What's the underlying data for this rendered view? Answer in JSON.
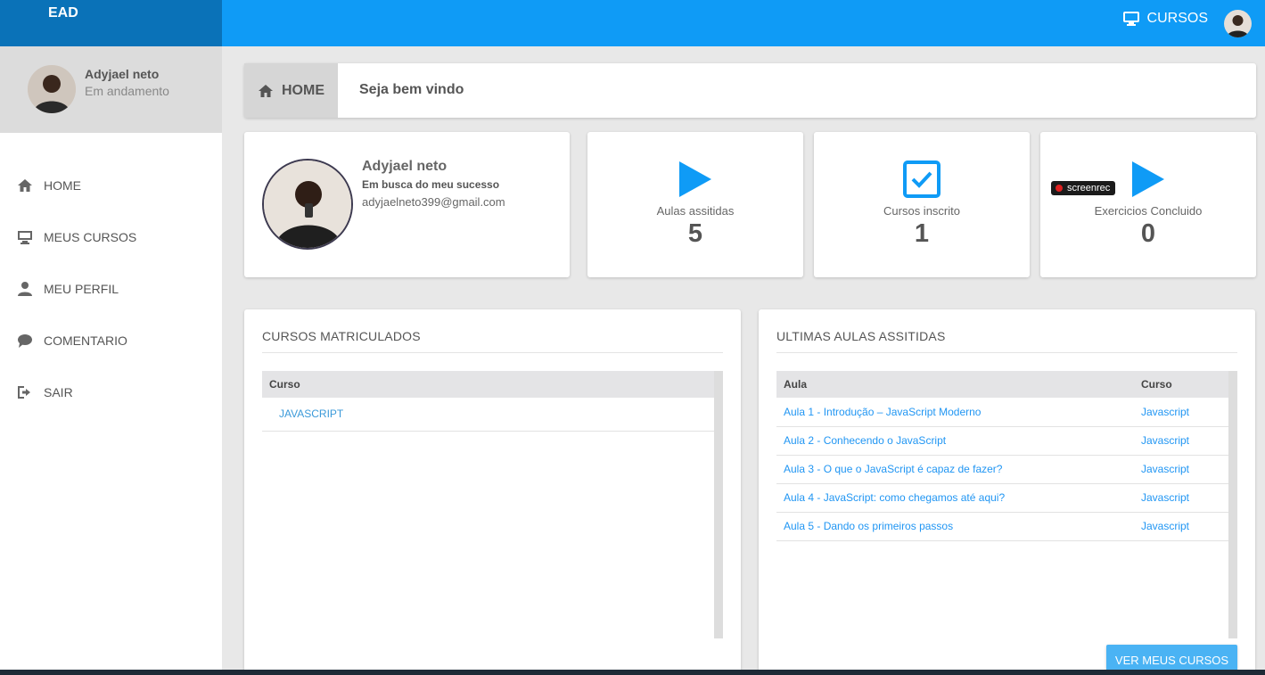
{
  "app": {
    "brand": "EAD"
  },
  "header": {
    "courses_label": "CURSOS"
  },
  "sidebar": {
    "user_name": "Adyjael neto",
    "user_status": "Em andamento",
    "items": [
      {
        "label": "HOME",
        "icon": "home-icon"
      },
      {
        "label": "MEUS CURSOS",
        "icon": "monitor-icon"
      },
      {
        "label": "MEU PERFIL",
        "icon": "user-icon"
      },
      {
        "label": "COMENTARIO",
        "icon": "comment-icon"
      },
      {
        "label": "SAIR",
        "icon": "logout-icon"
      }
    ]
  },
  "breadcrumb": {
    "home": "HOME",
    "welcome": "Seja bem vindo"
  },
  "profile": {
    "name": "Adyjael neto",
    "slogan": "Em busca do meu sucesso",
    "email": "adyjaelneto399@gmail.com"
  },
  "stats": [
    {
      "label": "Aulas assitidas",
      "value": "5",
      "icon": "play-icon"
    },
    {
      "label": "Cursos inscrito",
      "value": "1",
      "icon": "checkbox-icon"
    },
    {
      "label": "Exercicios Concluido",
      "value": "0",
      "icon": "play-icon",
      "overlay": "screenrec"
    }
  ],
  "enrolled": {
    "title": "CURSOS MATRICULADOS",
    "header": "Curso",
    "rows": [
      "JAVASCRIPT"
    ]
  },
  "recent": {
    "title": "ULTIMAS AULAS ASSITIDAS",
    "headers": [
      "Aula",
      "Curso"
    ],
    "rows": [
      {
        "aula": "Aula 1 - Introdução – JavaScript Moderno",
        "curso": "Javascript"
      },
      {
        "aula": "Aula 2 - Conhecendo o JavaScript",
        "curso": "Javascript"
      },
      {
        "aula": "Aula 3 - O que o JavaScript é capaz de fazer?",
        "curso": "Javascript"
      },
      {
        "aula": "Aula 4 - JavaScript: como chegamos até aqui?",
        "curso": "Javascript"
      },
      {
        "aula": "Aula 5 - Dando os primeiros passos",
        "curso": "Javascript"
      }
    ],
    "button": "VER MEUS CURSOS"
  },
  "colors": {
    "primary": "#0f9bf6",
    "brand_dark": "#0a72b8",
    "link": "#2196f3"
  }
}
